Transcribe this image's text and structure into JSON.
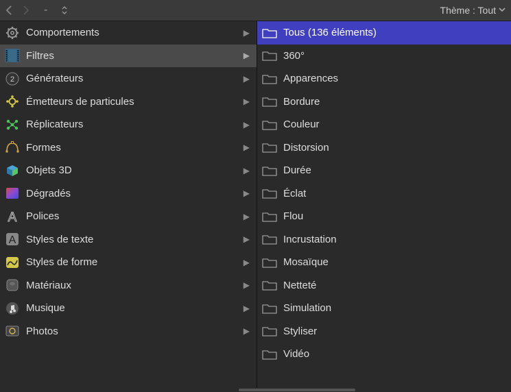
{
  "toolbar": {
    "theme_label": "Thème : Tout",
    "minus": "-"
  },
  "left_column": {
    "items": [
      {
        "key": "comportements",
        "label": "Comportements",
        "icon": "gear",
        "selected": false
      },
      {
        "key": "filtres",
        "label": "Filtres",
        "icon": "filmstrip",
        "selected": true
      },
      {
        "key": "generateurs",
        "label": "Générateurs",
        "icon": "gen2",
        "selected": false
      },
      {
        "key": "emetteurs",
        "label": "Émetteurs de particules",
        "icon": "emitter",
        "selected": false
      },
      {
        "key": "replicateurs",
        "label": "Réplicateurs",
        "icon": "replicator",
        "selected": false
      },
      {
        "key": "formes",
        "label": "Formes",
        "icon": "shape",
        "selected": false
      },
      {
        "key": "objets3d",
        "label": "Objets 3D",
        "icon": "cube3d",
        "selected": false
      },
      {
        "key": "degrades",
        "label": "Dégradés",
        "icon": "gradient",
        "selected": false
      },
      {
        "key": "polices",
        "label": "Polices",
        "icon": "font-outline",
        "selected": false
      },
      {
        "key": "styles-texte",
        "label": "Styles de texte",
        "icon": "font-solid",
        "selected": false
      },
      {
        "key": "styles-forme",
        "label": "Styles de forme",
        "icon": "shape-style",
        "selected": false
      },
      {
        "key": "materiaux",
        "label": "Matériaux",
        "icon": "material",
        "selected": false
      },
      {
        "key": "musique",
        "label": "Musique",
        "icon": "music",
        "selected": false
      },
      {
        "key": "photos",
        "label": "Photos",
        "icon": "photos",
        "selected": false
      }
    ]
  },
  "right_column": {
    "items": [
      {
        "label": "Tous (136 éléments)",
        "selected": true
      },
      {
        "label": "360°",
        "selected": false
      },
      {
        "label": "Apparences",
        "selected": false
      },
      {
        "label": "Bordure",
        "selected": false
      },
      {
        "label": "Couleur",
        "selected": false
      },
      {
        "label": "Distorsion",
        "selected": false
      },
      {
        "label": "Durée",
        "selected": false
      },
      {
        "label": "Éclat",
        "selected": false
      },
      {
        "label": "Flou",
        "selected": false
      },
      {
        "label": "Incrustation",
        "selected": false
      },
      {
        "label": "Mosaïque",
        "selected": false
      },
      {
        "label": "Netteté",
        "selected": false
      },
      {
        "label": "Simulation",
        "selected": false
      },
      {
        "label": "Styliser",
        "selected": false
      },
      {
        "label": "Vidéo",
        "selected": false
      }
    ]
  }
}
